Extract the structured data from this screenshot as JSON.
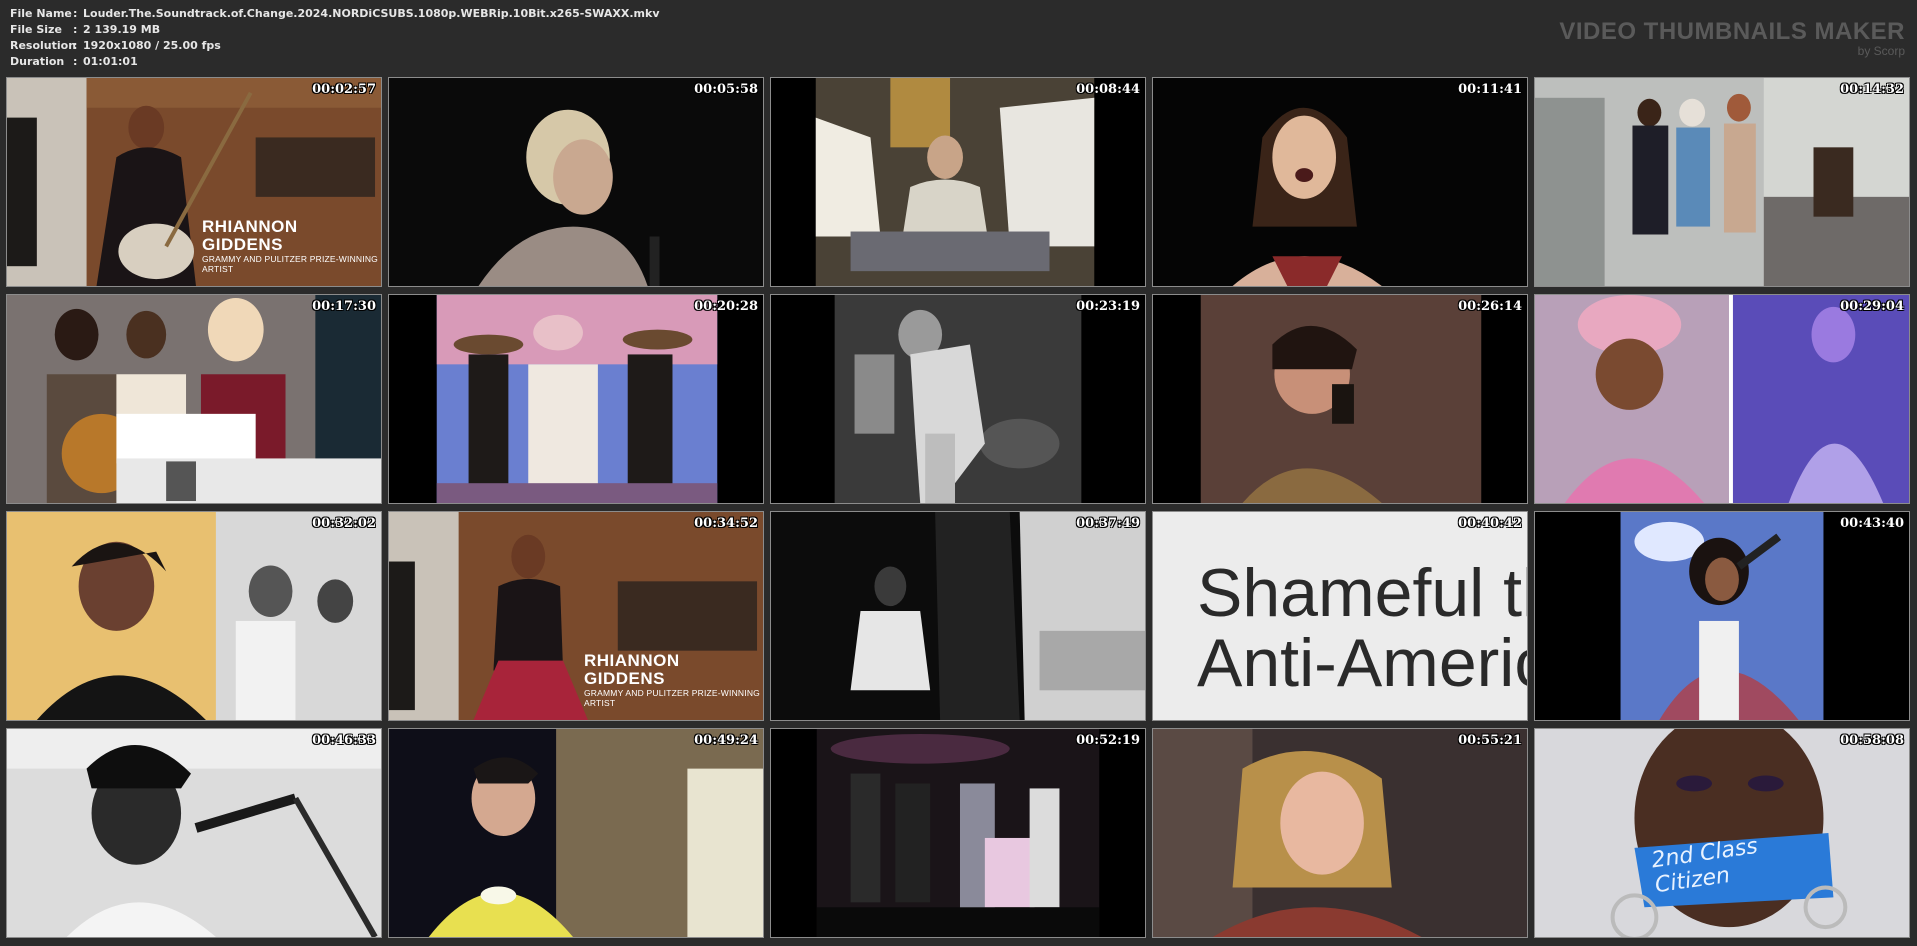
{
  "file_info": [
    {
      "label": "File Name",
      "value": "Louder.The.Soundtrack.of.Change.2024.NORDiCSUBS.1080p.WEBRip.10Bit.x265-SWAXX.mkv"
    },
    {
      "label": "File Size",
      "value": "2 139.19 MB"
    },
    {
      "label": "Resolution",
      "value": "1920x1080 / 25.00 fps"
    },
    {
      "label": "Duration",
      "value": "01:01:01"
    }
  ],
  "separator": ":",
  "brand": {
    "title": "VIDEO THUMBNAILS MAKER",
    "subtitle": "by Scorp"
  },
  "thumbnails": [
    {
      "time": "00:02:57"
    },
    {
      "time": "00:05:58"
    },
    {
      "time": "00:08:44"
    },
    {
      "time": "00:11:41"
    },
    {
      "time": "00:14:32"
    },
    {
      "time": "00:17:30"
    },
    {
      "time": "00:20:28"
    },
    {
      "time": "00:23:19"
    },
    {
      "time": "00:26:14"
    },
    {
      "time": "00:29:04"
    },
    {
      "time": "00:32:02"
    },
    {
      "time": "00:34:52"
    },
    {
      "time": "00:37:49"
    },
    {
      "time": "00:40:42"
    },
    {
      "time": "00:43:40"
    },
    {
      "time": "00:46:33"
    },
    {
      "time": "00:49:24"
    },
    {
      "time": "00:52:19"
    },
    {
      "time": "00:55:21"
    },
    {
      "time": "00:58:08"
    }
  ],
  "captions": {
    "thumb1_name": "RHIANNON GIDDENS",
    "thumb1_sub": "GRAMMY AND PULITZER PRIZE-WINNING ARTIST",
    "thumb12_name": "RHIANNON GIDDENS",
    "thumb12_sub": "GRAMMY AND PULITZER PRIZE-WINNING ARTIST",
    "thumb14_line1": "Shameful th",
    "thumb14_line2": "Anti-Americ",
    "thumb20_tape_line1": "2nd Class",
    "thumb20_tape_line2": "Citizen"
  },
  "colors": {
    "background": "#2b2b2b",
    "border": "#8c8c8c",
    "brand": "#5a5a5a"
  }
}
